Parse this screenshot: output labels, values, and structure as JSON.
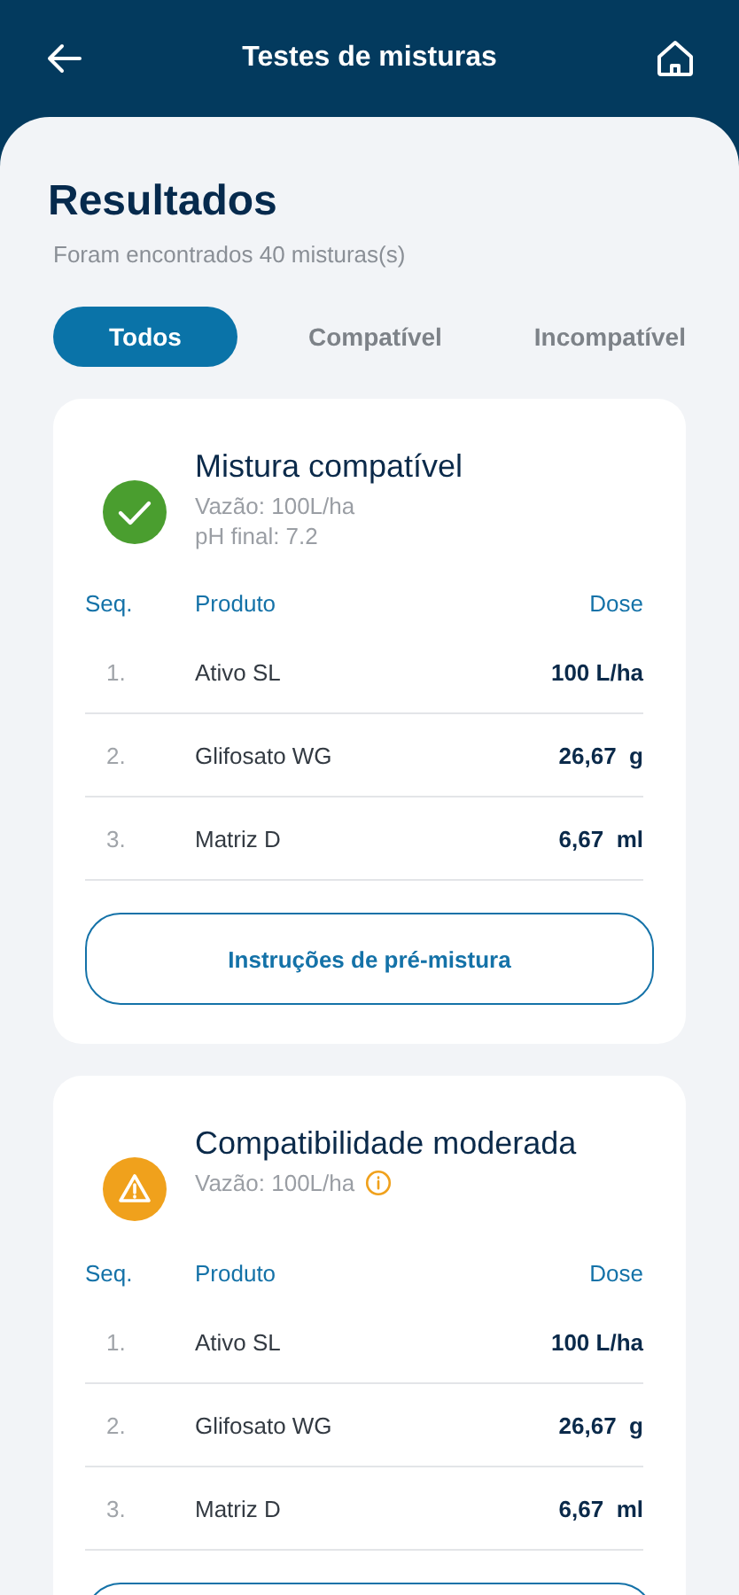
{
  "app_bar": {
    "title": "Testes de misturas"
  },
  "heading": "Resultados",
  "subtitle": "Foram encontrados 40 misturas(s)",
  "filters": [
    {
      "label": "Todos",
      "selected": true
    },
    {
      "label": "Compatível",
      "selected": false
    },
    {
      "label": "Incompatível",
      "selected": false
    }
  ],
  "results": [
    {
      "kind": "compatible",
      "title": "Mistura compatível",
      "details": [
        {
          "text": "Vazão: 100L/ha"
        },
        {
          "text": "pH final: 7.2"
        }
      ],
      "columns": [
        "Seq.",
        "Produto",
        "Dose"
      ],
      "rows": [
        {
          "seq": "1.",
          "product": "Ativo SL",
          "dose": "100 L/ha"
        },
        {
          "seq": "2.",
          "product": "Glifosato WG",
          "dose": "26,67  g"
        },
        {
          "seq": "3.",
          "product": "Matriz D",
          "dose": "6,67  ml"
        }
      ],
      "button": "Instruções de pré-mistura"
    },
    {
      "kind": "moderate",
      "title": "Compatibilidade moderada",
      "details": [
        {
          "text": "Vazão: 100L/ha",
          "info": true
        }
      ],
      "columns": [
        "Seq.",
        "Produto",
        "Dose"
      ],
      "rows": [
        {
          "seq": "1.",
          "product": "Ativo SL",
          "dose": "100 L/ha"
        },
        {
          "seq": "2.",
          "product": "Glifosato WG",
          "dose": "26,67  g"
        },
        {
          "seq": "3.",
          "product": "Matriz D",
          "dose": "6,67  ml"
        }
      ]
    }
  ]
}
